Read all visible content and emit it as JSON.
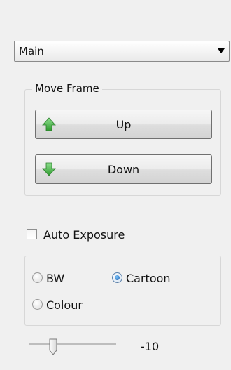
{
  "view_select": {
    "value": "Main"
  },
  "move_frame": {
    "legend": "Move Frame",
    "up_label": "Up",
    "down_label": "Down"
  },
  "auto_exposure": {
    "label": "Auto Exposure",
    "checked": false
  },
  "mode": {
    "options": [
      {
        "label": "BW",
        "checked": false
      },
      {
        "label": "Cartoon",
        "checked": true
      },
      {
        "label": "Colour",
        "checked": false
      }
    ]
  },
  "slider": {
    "value": -10,
    "min": -20,
    "max": 20,
    "display": "-10"
  },
  "colors": {
    "accent": "#3a8fd6",
    "arrow_green": "#3fae3f"
  }
}
